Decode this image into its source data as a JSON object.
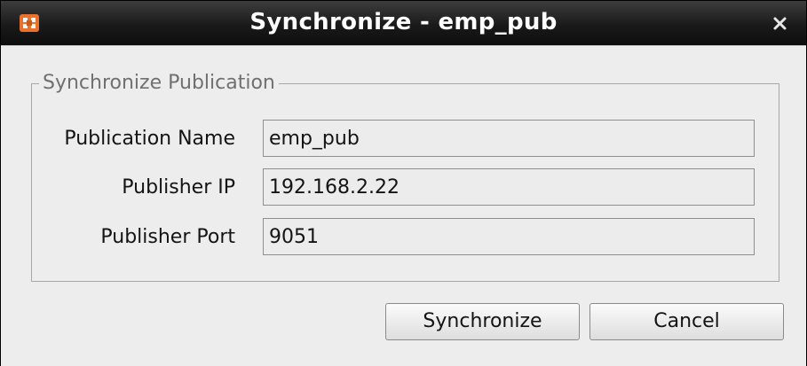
{
  "window": {
    "title": "Synchronize - emp_pub"
  },
  "icons": {
    "app": "app-icon",
    "close": "close-icon"
  },
  "group": {
    "legend": "Synchronize Publication"
  },
  "form": {
    "publication_name": {
      "label": "Publication Name",
      "value": "emp_pub"
    },
    "publisher_ip": {
      "label": "Publisher IP",
      "value": "192.168.2.22"
    },
    "publisher_port": {
      "label": "Publisher Port",
      "value": "9051"
    }
  },
  "buttons": {
    "synchronize_label": "Synchronize",
    "cancel_label": "Cancel"
  },
  "colors": {
    "titlebar": "#1a1a1a",
    "title_text": "#ffffff",
    "dialog_bg": "#ededed",
    "icon_orange": "#e8722c"
  }
}
